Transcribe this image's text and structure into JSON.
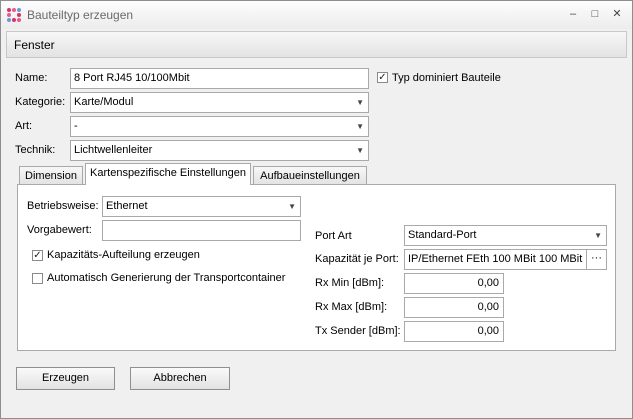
{
  "window": {
    "title": "Bauteiltyp erzeugen"
  },
  "menu": {
    "item": "Fenster"
  },
  "form": {
    "name_label": "Name:",
    "name_value": "8 Port RJ45 10/100Mbit",
    "typ_dominiert_label": "Typ dominiert Bauteile",
    "typ_dominiert_checked": true,
    "kategorie_label": "Kategorie:",
    "kategorie_value": "Karte/Modul",
    "art_label": "Art:",
    "art_value": "-",
    "technik_label": "Technik:",
    "technik_value": "Lichtwellenleiter"
  },
  "tabs": [
    {
      "label": "Dimension",
      "active": false
    },
    {
      "label": "Kartenspezifische Einstellungen",
      "active": true
    },
    {
      "label": "Aufbaueinstellungen",
      "active": false
    }
  ],
  "card": {
    "betriebsweise_label": "Betriebsweise:",
    "betriebsweise_value": "Ethernet",
    "vorgabewert_label": "Vorgabewert:",
    "vorgabewert_value": "",
    "kapazitaet_aufteilung_label": "Kapazitäts-Aufteilung erzeugen",
    "kapazitaet_aufteilung_checked": true,
    "auto_transport_label": "Automatisch Generierung der Transportcontainer",
    "auto_transport_checked": false,
    "port_art_label": "Port Art",
    "port_art_value": "Standard-Port",
    "kapazitaet_port_label": "Kapazität je Port:",
    "kapazitaet_port_value": "IP/Ethernet FEth 100 MBit 100 MBit",
    "ellipsis": "···",
    "rx_min_label": "Rx Min [dBm]:",
    "rx_min_value": "0,00",
    "rx_max_label": "Rx Max [dBm]:",
    "rx_max_value": "0,00",
    "tx_sender_label": "Tx Sender [dBm]:",
    "tx_sender_value": "0,00"
  },
  "buttons": {
    "create": "Erzeugen",
    "cancel": "Abbrechen"
  },
  "glyphs": {
    "minimize": "–",
    "maximize": "□",
    "close": "✕",
    "dropdown": "▼",
    "check": "✓"
  }
}
